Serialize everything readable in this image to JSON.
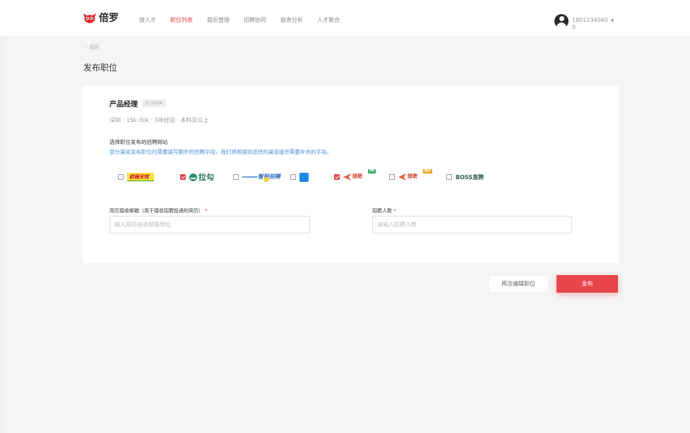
{
  "colors": {
    "accent": "#e8454d",
    "link": "#4a90d9",
    "background": "#f5f5f5"
  },
  "header": {
    "brand": "倍罗",
    "nav": [
      "搜人才",
      "职位列表",
      "简历管理",
      "招聘协同",
      "报表分析",
      "人才聚合"
    ],
    "active_nav": "职位列表",
    "user": {
      "name": "18012345600",
      "icon": "user-avatar-icon",
      "caret_icon": "caret-down-icon"
    }
  },
  "page": {
    "back": "返回",
    "back_icon": "chevron-left-icon",
    "title": "发布职位"
  },
  "job": {
    "title": "产品经理",
    "code": "8720QA",
    "meta": "深圳 · 15k-30k · 3年经验 · 本科及以上"
  },
  "channels": {
    "title": "选择职位发布的招聘网站",
    "desc": "部分渠道发布职位时需要填写额外的招聘字段，我们将根据你选择的渠道提示需要补充的字段。",
    "items": [
      {
        "logo_text": "前程无忧",
        "checked": false
      },
      {
        "logo_text": "拉勾",
        "checked": true
      },
      {
        "logo_text": "智联招聘",
        "checked": false
      },
      {
        "logo_text": "",
        "checked": false
      },
      {
        "logo_text": "猎聘",
        "badge": "HR",
        "checked": true
      },
      {
        "logo_text": "猎聘",
        "badge": "猎头",
        "checked": false
      },
      {
        "logo_text": "BOSS直聘",
        "checked": false
      }
    ]
  },
  "form": {
    "email_label": "简历接收邮箱（用于接收招聘投递的简历）",
    "email_placeholder": "输入简历接收邮箱地址",
    "count_label": "招聘人数",
    "count_placeholder": "请输入招聘人数",
    "required_mark": "*"
  },
  "actions": {
    "re_edit": "再次编辑职位",
    "publish": "发布"
  }
}
